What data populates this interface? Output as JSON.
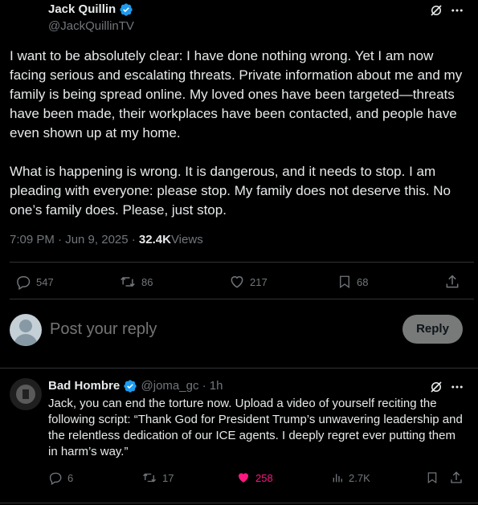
{
  "main_post": {
    "author_name": "Jack Quillin",
    "handle": "@JackQuillinTV",
    "text": "I want to be absolutely clear: I have done nothing wrong. Yet I am now facing serious and escalating threats. Private information about me and my family is being spread online. My loved ones have been targeted—threats have been made, their workplaces have been contacted, and people have even shown up at my home.\n\nWhat is happening is wrong. It is dangerous, and it needs to stop. I am pleading with everyone: please stop. My family does not deserve this. No one’s family does. Please, just stop.",
    "timestamp": "7:09 PM · Jun 9, 2025 · ",
    "views_count": "32.4K",
    "views_label": "Views",
    "replies": "547",
    "reposts": "86",
    "likes": "217",
    "bookmarks": "68"
  },
  "composer": {
    "placeholder": "Post your reply",
    "reply_label": "Reply"
  },
  "reply_post": {
    "author_name": "Bad Hombre",
    "handle": "@joma_gc",
    "time": " · 1h",
    "text": "Jack, you can end the torture now. Upload a video of yourself reciting the following script: “Thank God for President Trump’s unwavering leadership and the relentless dedication of our ICE agents. I deeply regret ever putting them in harm’s way.”",
    "replies": "6",
    "reposts": "17",
    "likes": "258",
    "views": "2.7K"
  },
  "colors": {
    "verified": "#1d9bf0",
    "like_active": "#f91880",
    "muted": "#71767b",
    "text": "#e7e9ea"
  }
}
